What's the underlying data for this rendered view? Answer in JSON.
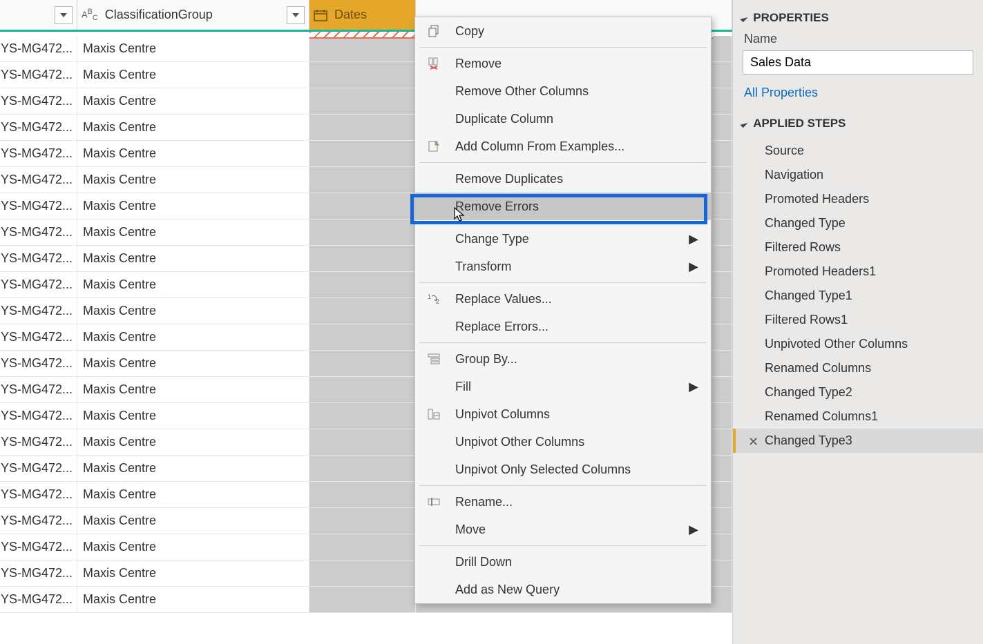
{
  "columns": {
    "class_group": "ClassificationGroup",
    "dates": "Dates"
  },
  "rows": [
    {
      "a": "YS-MG472...",
      "b": "Maxis Centre"
    },
    {
      "a": "YS-MG472...",
      "b": "Maxis Centre"
    },
    {
      "a": "YS-MG472...",
      "b": "Maxis Centre"
    },
    {
      "a": "YS-MG472...",
      "b": "Maxis Centre"
    },
    {
      "a": "YS-MG472...",
      "b": "Maxis Centre"
    },
    {
      "a": "YS-MG472...",
      "b": "Maxis Centre"
    },
    {
      "a": "YS-MG472...",
      "b": "Maxis Centre"
    },
    {
      "a": "YS-MG472...",
      "b": "Maxis Centre"
    },
    {
      "a": "YS-MG472...",
      "b": "Maxis Centre"
    },
    {
      "a": "YS-MG472...",
      "b": "Maxis Centre"
    },
    {
      "a": "YS-MG472...",
      "b": "Maxis Centre"
    },
    {
      "a": "YS-MG472...",
      "b": "Maxis Centre"
    },
    {
      "a": "YS-MG472...",
      "b": "Maxis Centre"
    },
    {
      "a": "YS-MG472...",
      "b": "Maxis Centre"
    },
    {
      "a": "YS-MG472...",
      "b": "Maxis Centre"
    },
    {
      "a": "YS-MG472...",
      "b": "Maxis Centre"
    },
    {
      "a": "YS-MG472...",
      "b": "Maxis Centre"
    },
    {
      "a": "YS-MG472...",
      "b": "Maxis Centre"
    },
    {
      "a": "YS-MG472...",
      "b": "Maxis Centre"
    },
    {
      "a": "YS-MG472...",
      "b": "Maxis Centre"
    },
    {
      "a": "YS-MG472...",
      "b": "Maxis Centre"
    },
    {
      "a": "YS-MG472...",
      "b": "Maxis Centre"
    }
  ],
  "menu": {
    "copy": "Copy",
    "remove": "Remove",
    "remove_other": "Remove Other Columns",
    "duplicate": "Duplicate Column",
    "add_from_examples": "Add Column From Examples...",
    "remove_duplicates": "Remove Duplicates",
    "remove_errors": "Remove Errors",
    "change_type": "Change Type",
    "transform": "Transform",
    "replace_values": "Replace Values...",
    "replace_errors": "Replace Errors...",
    "group_by": "Group By...",
    "fill": "Fill",
    "unpivot": "Unpivot Columns",
    "unpivot_other": "Unpivot Other Columns",
    "unpivot_selected": "Unpivot Only Selected Columns",
    "rename": "Rename...",
    "move": "Move",
    "drill_down": "Drill Down",
    "add_as_new_query": "Add as New Query"
  },
  "properties": {
    "section_title": "PROPERTIES",
    "name_label": "Name",
    "name_value": "Sales Data",
    "all_properties": "All Properties"
  },
  "steps": {
    "section_title": "APPLIED STEPS",
    "items": [
      "Source",
      "Navigation",
      "Promoted Headers",
      "Changed Type",
      "Filtered Rows",
      "Promoted Headers1",
      "Changed Type1",
      "Filtered Rows1",
      "Unpivoted Other Columns",
      "Renamed Columns",
      "Changed Type2",
      "Renamed Columns1",
      "Changed Type3"
    ],
    "selected_index": 12
  }
}
